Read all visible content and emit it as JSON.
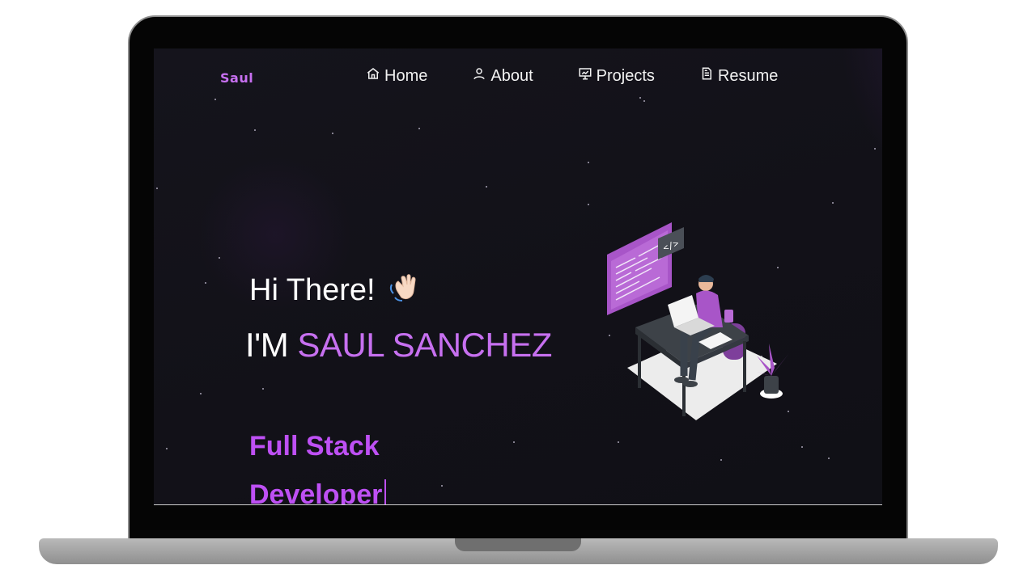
{
  "nav": {
    "logo": "Saul",
    "items": [
      {
        "label": "Home",
        "icon": "home-icon"
      },
      {
        "label": "About",
        "icon": "user-icon"
      },
      {
        "label": "Projects",
        "icon": "projects-icon"
      },
      {
        "label": "Resume",
        "icon": "document-icon"
      }
    ]
  },
  "hero": {
    "greeting": "Hi There!",
    "wave_icon": "waving-hand-icon",
    "name_prefix": "I'M ",
    "name": "SAUL SANCHEZ",
    "role_line1": "Full Stack",
    "role_line2": "Developer"
  },
  "colors": {
    "accent": "#c770f0",
    "role": "#be50f4",
    "background": "#131219"
  }
}
